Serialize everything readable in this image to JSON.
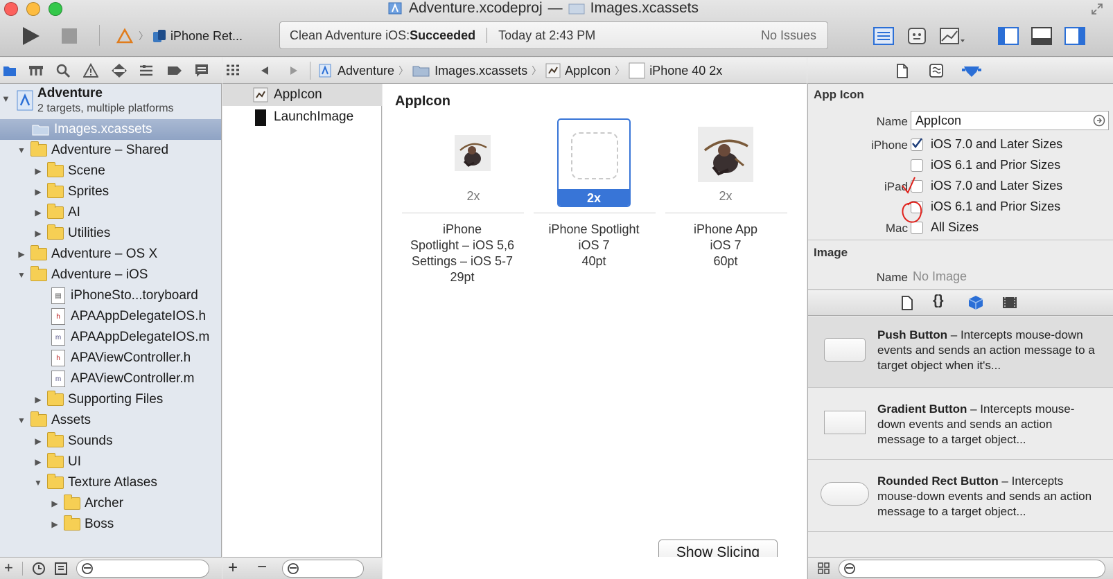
{
  "window": {
    "project": "Adventure.xcodeproj",
    "dash": "—",
    "catalog": "Images.xcassets"
  },
  "toolbar": {
    "scheme": "iPhone Ret...",
    "status_prefix": "Clean Adventure iOS: ",
    "status_result": "Succeeded",
    "status_time": "Today at 2:43 PM",
    "issues": "No Issues"
  },
  "jumpbar": {
    "crumbs": [
      "Adventure",
      "Images.xcassets",
      "AppIcon",
      "iPhone 40 2x"
    ]
  },
  "navigator": {
    "project_name": "Adventure",
    "project_sub": "2 targets, multiple platforms",
    "items": [
      {
        "label": "Images.xcassets",
        "kind": "catalog",
        "selected": true
      },
      {
        "label": "Adventure – Shared",
        "kind": "folder",
        "expanded": true
      },
      {
        "label": "Scene",
        "kind": "folder"
      },
      {
        "label": "Sprites",
        "kind": "folder"
      },
      {
        "label": "AI",
        "kind": "folder"
      },
      {
        "label": "Utilities",
        "kind": "folder"
      },
      {
        "label": "Adventure – OS X",
        "kind": "folder"
      },
      {
        "label": "Adventure – iOS",
        "kind": "folder",
        "expanded": true
      },
      {
        "label": "iPhoneSto...toryboard",
        "kind": "storyboard"
      },
      {
        "label": "APAAppDelegateIOS.h",
        "kind": "h"
      },
      {
        "label": "APAAppDelegateIOS.m",
        "kind": "m"
      },
      {
        "label": "APAViewController.h",
        "kind": "h"
      },
      {
        "label": "APAViewController.m",
        "kind": "m"
      },
      {
        "label": "Supporting Files",
        "kind": "folder"
      },
      {
        "label": "Assets",
        "kind": "folder",
        "expanded": true
      },
      {
        "label": "Sounds",
        "kind": "folder"
      },
      {
        "label": "UI",
        "kind": "folder"
      },
      {
        "label": "Texture Atlases",
        "kind": "folder",
        "expanded": true
      },
      {
        "label": "Archer",
        "kind": "folder"
      },
      {
        "label": "Boss",
        "kind": "folder"
      }
    ]
  },
  "assets": {
    "items": [
      "AppIcon",
      "LaunchImage"
    ]
  },
  "editor": {
    "title": "AppIcon",
    "slots": [
      {
        "scale": "2x",
        "caption": [
          "iPhone",
          "Spotlight – iOS 5,6",
          "Settings – iOS 5-7",
          "29pt"
        ]
      },
      {
        "scale": "2x",
        "caption": [
          "iPhone Spotlight",
          "iOS 7",
          "40pt"
        ]
      },
      {
        "scale": "2x",
        "caption": [
          "iPhone App",
          "iOS 7",
          "60pt"
        ]
      }
    ],
    "show_slicing": "Show Slicing"
  },
  "inspector": {
    "section_app_icon": "App Icon",
    "name_label": "Name",
    "name_value": "AppIcon",
    "iphone_label": "iPhone",
    "ipad_label": "iPad",
    "mac_label": "Mac",
    "opt_ios7": "iOS 7.0 and Later Sizes",
    "opt_ios61": "iOS 6.1 and Prior Sizes",
    "opt_all": "All Sizes",
    "section_image": "Image",
    "image_name_label": "Name",
    "image_name_value": "No Image",
    "library": [
      {
        "title": "Push Button",
        "desc": " – Intercepts mouse-down events and sends an action message to a target object when it's..."
      },
      {
        "title": "Gradient Button",
        "desc": " – Intercepts mouse-down events and sends an action message to a target object..."
      },
      {
        "title": "Rounded Rect Button",
        "desc": " – Intercepts mouse-down events and sends an action message to a target object..."
      }
    ]
  },
  "colors": {
    "selection": "#3875d7",
    "sidebar": "#e3e8ef",
    "annotation": "#e0211b"
  }
}
